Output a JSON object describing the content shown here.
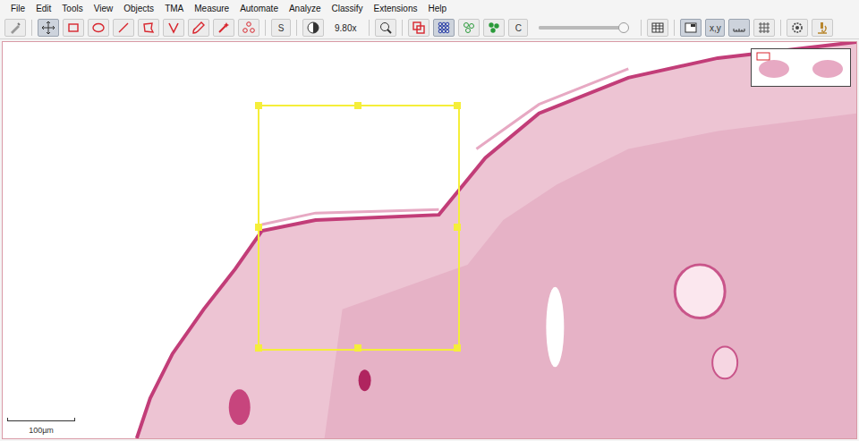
{
  "window": {
    "app": "QuPath"
  },
  "menu": [
    "File",
    "Edit",
    "Tools",
    "View",
    "Objects",
    "TMA",
    "Measure",
    "Automate",
    "Analyze",
    "Classify",
    "Extensions",
    "Help"
  ],
  "toolbar": [
    {
      "kind": "icon",
      "selected": false
    },
    {
      "kind": "separator"
    },
    {
      "kind": "icon",
      "selected": true
    },
    {
      "kind": "icon",
      "selected": false
    },
    {
      "kind": "icon",
      "selected": false
    },
    {
      "kind": "icon",
      "selected": false
    },
    {
      "kind": "icon",
      "selected": false
    },
    {
      "kind": "icon",
      "selected": false
    },
    {
      "kind": "icon",
      "selected": false
    },
    {
      "kind": "icon",
      "selected": false
    },
    {
      "kind": "icon",
      "selected": false
    },
    {
      "kind": "separator"
    },
    {
      "kind": "text",
      "label": "S",
      "selected": false
    },
    {
      "kind": "separator"
    },
    {
      "kind": "icon",
      "selected": false
    },
    {
      "kind": "label",
      "label": "9.80x"
    },
    {
      "kind": "separator"
    },
    {
      "kind": "icon",
      "selected": false
    },
    {
      "kind": "separator"
    },
    {
      "kind": "icon",
      "selected": false
    },
    {
      "kind": "icon",
      "selected": true
    },
    {
      "kind": "icon",
      "selected": false
    },
    {
      "kind": "icon",
      "selected": false
    },
    {
      "kind": "text",
      "label": "C",
      "selected": false
    },
    {
      "kind": "slider",
      "level": 0.95
    },
    {
      "kind": "separator"
    },
    {
      "kind": "icon",
      "selected": false
    },
    {
      "kind": "separator"
    },
    {
      "kind": "icon",
      "selected": true
    },
    {
      "kind": "text",
      "label": "x,y",
      "selected": true
    },
    {
      "kind": "icon",
      "selected": true
    },
    {
      "kind": "icon",
      "selected": false
    },
    {
      "kind": "separator"
    },
    {
      "kind": "icon",
      "selected": false
    },
    {
      "kind": "icon",
      "selected": false
    }
  ],
  "viewer": {
    "scale_bar": {
      "label": "100µm"
    },
    "annotation": {
      "selected": true
    },
    "overview": {
      "visible": true
    }
  }
}
